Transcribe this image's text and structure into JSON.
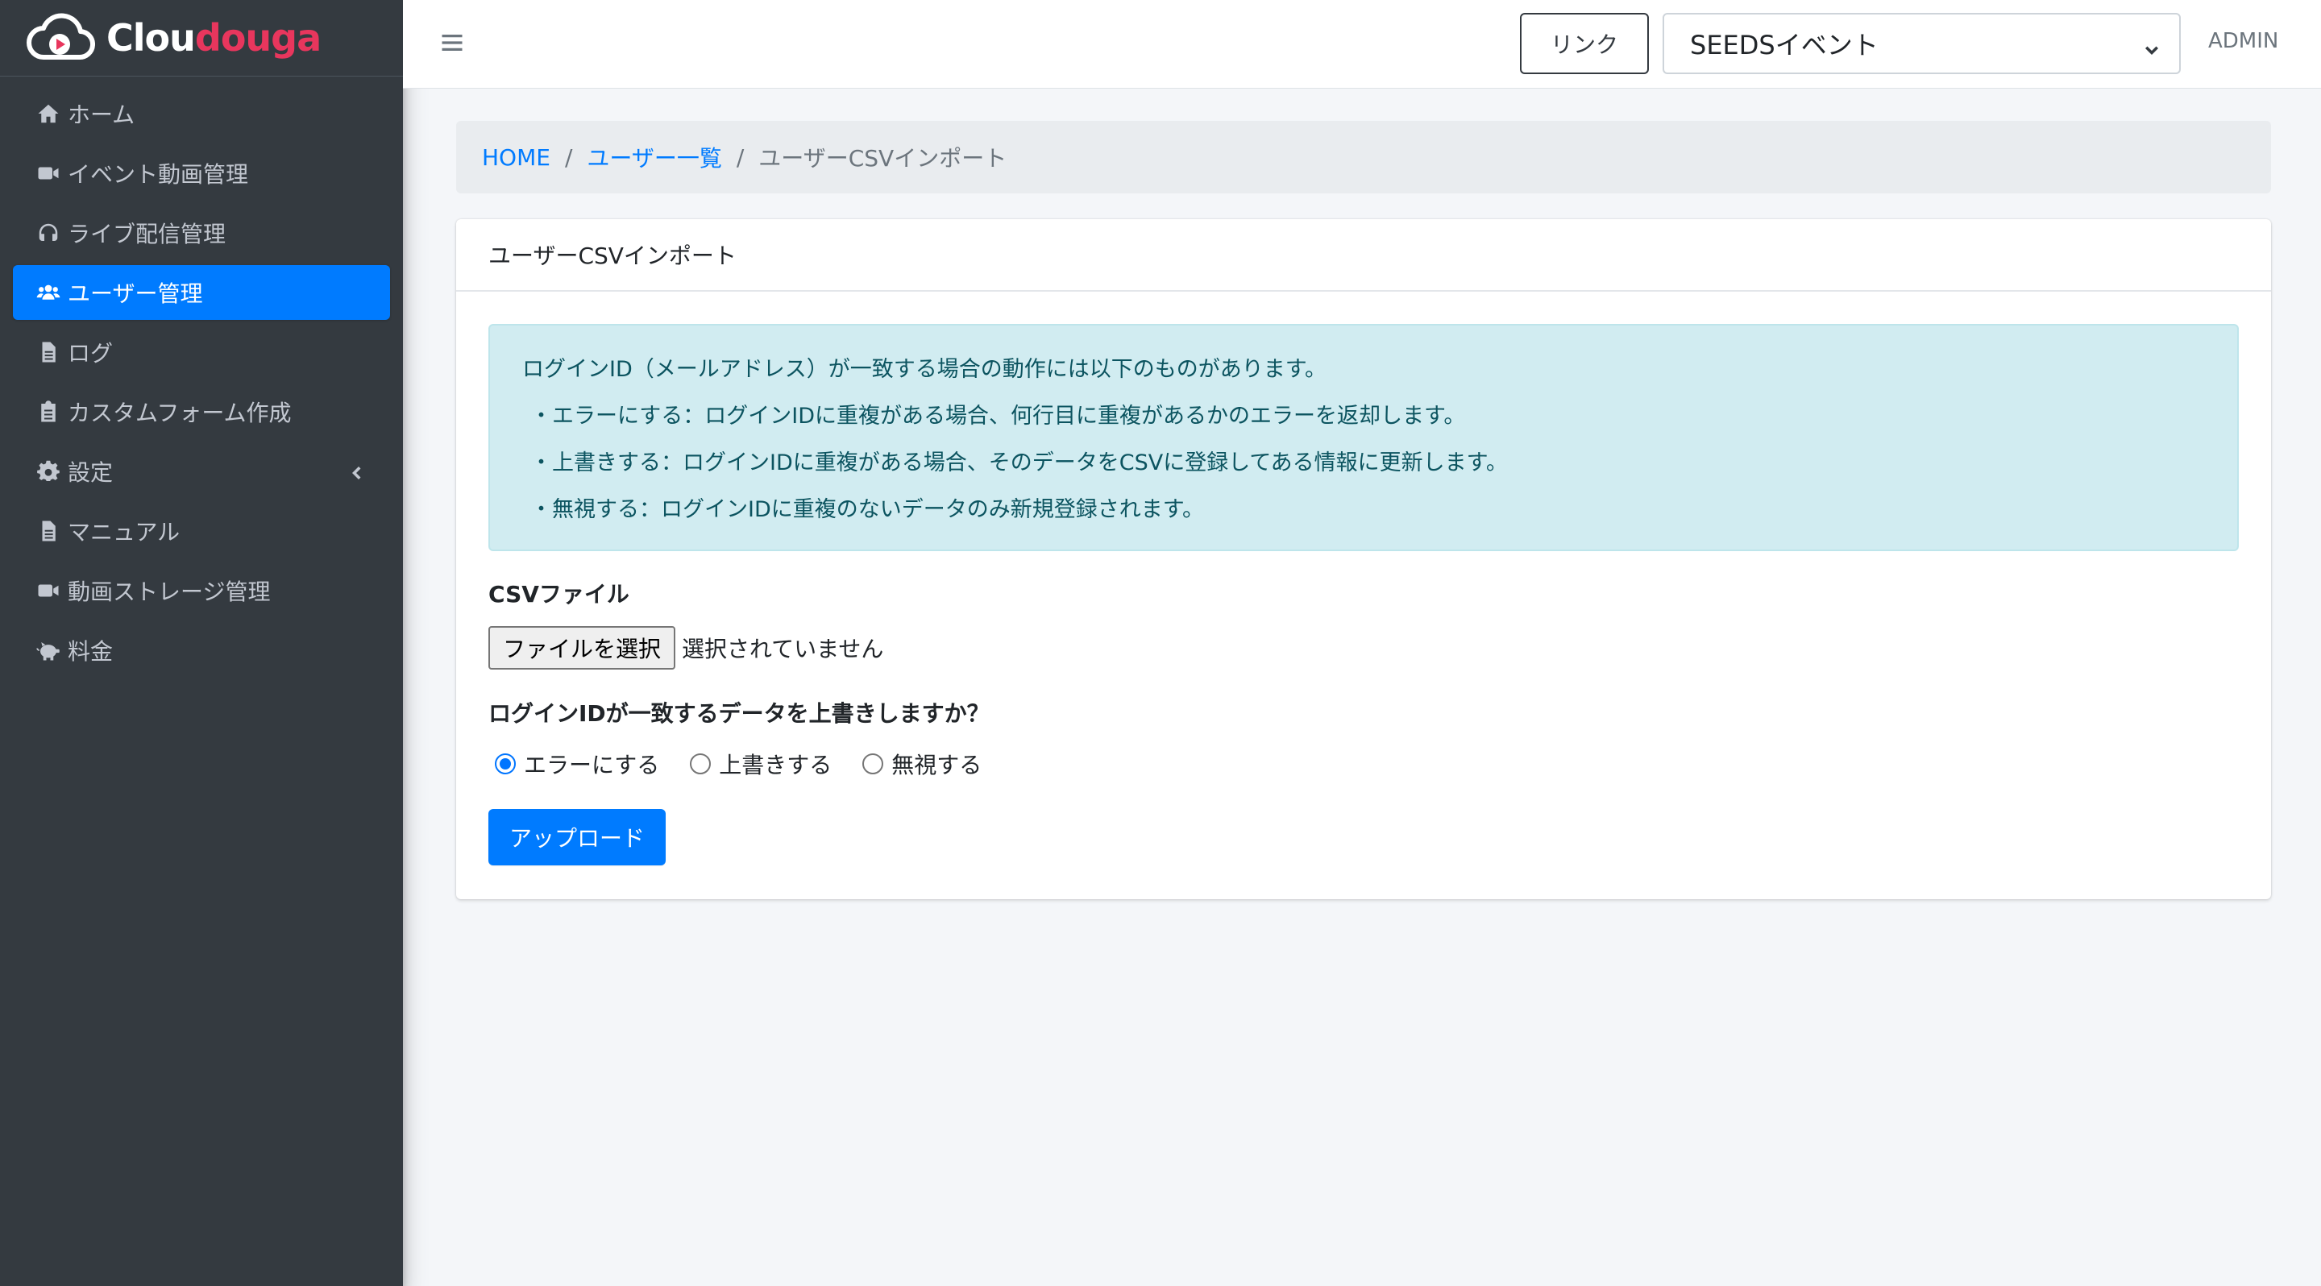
{
  "brand": {
    "prefix": "Clou",
    "accent": "douga",
    "accent_color": "#e8365d"
  },
  "sidebar": {
    "items": [
      {
        "label": "ホーム",
        "icon": "home-icon"
      },
      {
        "label": "イベント動画管理",
        "icon": "video-camera-icon"
      },
      {
        "label": "ライブ配信管理",
        "icon": "headset-icon"
      },
      {
        "label": "ユーザー管理",
        "icon": "users-icon",
        "active": true
      },
      {
        "label": "ログ",
        "icon": "file-icon"
      },
      {
        "label": "カスタムフォーム作成",
        "icon": "clipboard-icon"
      },
      {
        "label": "設定",
        "icon": "gear-icon",
        "has_caret": true
      },
      {
        "label": "マニュアル",
        "icon": "file-icon"
      },
      {
        "label": "動画ストレージ管理",
        "icon": "video-camera-icon"
      },
      {
        "label": "料金",
        "icon": "piggy-bank-icon"
      }
    ]
  },
  "navbar": {
    "link_label": "リンク",
    "event_select": {
      "selected": "SEEDSイベント"
    },
    "user_label": "ADMIN"
  },
  "breadcrumb": {
    "home": "HOME",
    "users": "ユーザー一覧",
    "current": "ユーザーCSVインポート"
  },
  "card": {
    "title": "ユーザーCSVインポート",
    "alert": {
      "intro": "ログインID（メールアドレス）が一致する場合の動作には以下のものがあります。",
      "lines": [
        "・エラーにする：ログインIDに重複がある場合、何行目に重複があるかのエラーを返却します。",
        "・上書きする：ログインIDに重複がある場合、そのデータをCSVに登録してある情報に更新します。",
        "・無視する：ログインIDに重複のないデータのみ新規登録されます。"
      ]
    },
    "file_label": "CSVファイル",
    "file_button": "ファイルを選択",
    "file_status": "選択されていません",
    "overwrite_question": "ログインIDが一致するデータを上書きしますか？",
    "options": [
      "エラーにする",
      "上書きする",
      "無視する"
    ],
    "selected_option": "エラーにする",
    "upload_label": "アップロード"
  },
  "colors": {
    "primary": "#007bff",
    "sidebar_bg": "#343a40",
    "alert_bg": "#d1ecf1",
    "alert_text": "#0c5460"
  }
}
